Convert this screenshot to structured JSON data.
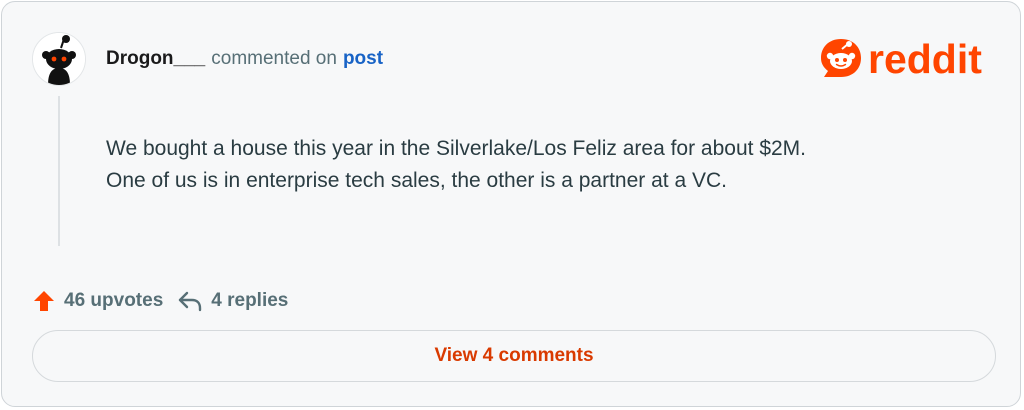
{
  "comment": {
    "author": "Drogon___",
    "action_text": "commented on",
    "target_link": "post",
    "body_lines": [
      "We bought a house this year in the Silverlake/Los Feliz area for about $2M.",
      "One of us is in enterprise tech sales, the other is a partner at a VC."
    ]
  },
  "brand": {
    "wordmark": "reddit",
    "color": "#ff4500"
  },
  "stats": {
    "upvotes": "46 upvotes",
    "replies": "4 replies"
  },
  "cta": {
    "view_comments": "View 4 comments",
    "color": "#d93a00"
  },
  "icons": {
    "avatar": "snoo-avatar-icon",
    "upvote": "upvote-arrow-icon",
    "reply": "reply-arrow-icon",
    "logo": "reddit-snoo-icon"
  }
}
